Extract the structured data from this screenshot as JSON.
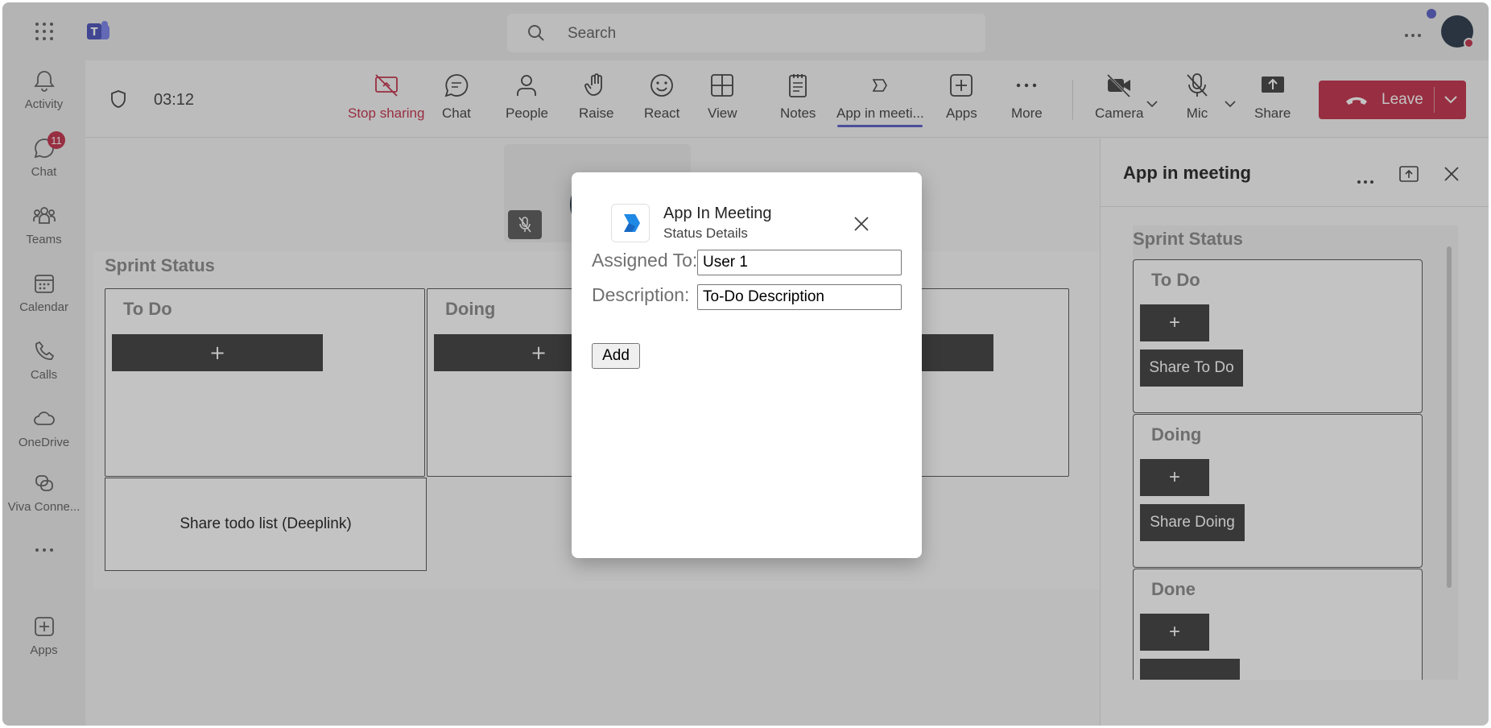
{
  "search": {
    "placeholder": "Search"
  },
  "rail": {
    "items": [
      {
        "label": "Activity",
        "icon": "bell-icon"
      },
      {
        "label": "Chat",
        "icon": "chat-icon",
        "badge": "11"
      },
      {
        "label": "Teams",
        "icon": "teams-icon"
      },
      {
        "label": "Calendar",
        "icon": "calendar-icon"
      },
      {
        "label": "Calls",
        "icon": "phone-icon"
      },
      {
        "label": "OneDrive",
        "icon": "cloud-icon"
      },
      {
        "label": "Viva Conne...",
        "icon": "viva-icon"
      },
      {
        "label": "",
        "icon": "more-icon"
      },
      {
        "label": "Apps",
        "icon": "add-apps-icon"
      }
    ]
  },
  "meeting": {
    "timer": "03:12",
    "controls": {
      "stop_sharing": "Stop sharing",
      "chat": "Chat",
      "people": "People",
      "raise": "Raise",
      "react": "React",
      "view": "View",
      "notes": "Notes",
      "app_in_meeting": "App in meeti...",
      "apps": "Apps",
      "more": "More",
      "camera": "Camera",
      "mic": "Mic",
      "share": "Share",
      "leave": "Leave"
    },
    "accent": "#c4314b"
  },
  "stage": {
    "board_title": "Sprint Status",
    "columns": [
      "To Do",
      "Doing"
    ],
    "plus": "+",
    "share_deeplink": "Share todo list (Deeplink)"
  },
  "panel": {
    "title": "App in meeting",
    "board_title": "Sprint Status",
    "columns": [
      {
        "title": "To Do",
        "share": "Share To Do"
      },
      {
        "title": "Doing",
        "share": "Share Doing"
      },
      {
        "title": "Done",
        "share": ""
      }
    ],
    "plus": "+"
  },
  "dialog": {
    "title": "App In Meeting",
    "subtitle": "Status Details",
    "assigned_label": "Assigned To:",
    "assigned_value": "User 1",
    "description_label": "Description:",
    "description_value": "To-Do Description",
    "add_label": "Add"
  }
}
